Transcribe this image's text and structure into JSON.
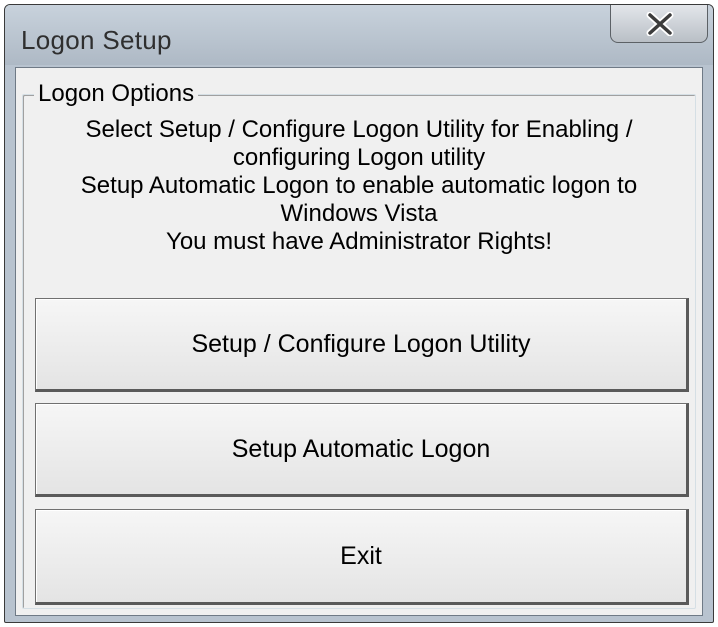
{
  "window": {
    "title": "Logon Setup"
  },
  "group": {
    "legend": "Logon Options"
  },
  "info_lines": [
    "Select Setup / Configure Logon Utility for Enabling /",
    "configuring Logon utility",
    "Setup Automatic Logon to enable automatic logon to",
    "Windows Vista",
    "You must have Administrator Rights!"
  ],
  "buttons": {
    "setup_configure": "Setup / Configure Logon Utility",
    "setup_automatic": "Setup Automatic Logon",
    "exit": "Exit"
  },
  "icons": {
    "close": "close-icon"
  }
}
